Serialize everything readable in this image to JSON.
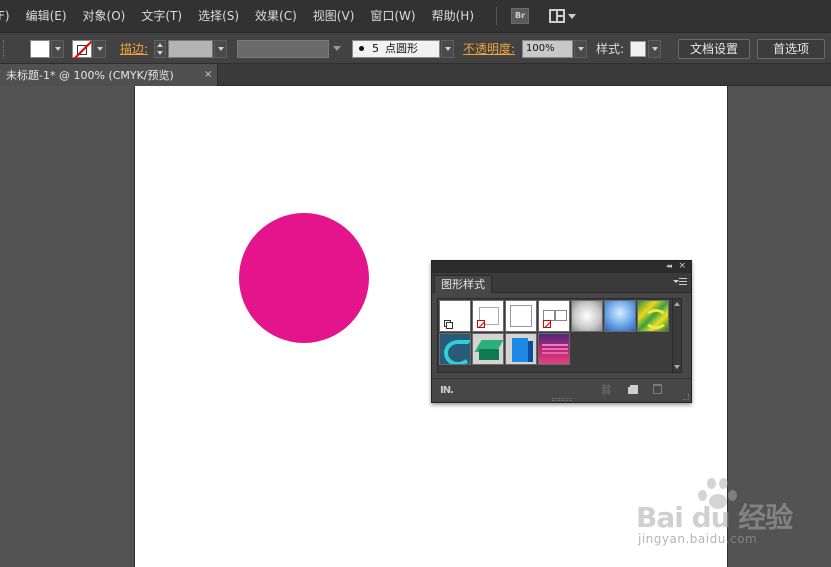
{
  "menubar": {
    "items": [
      "F)",
      "编辑(E)",
      "对象(O)",
      "文字(T)",
      "选择(S)",
      "效果(C)",
      "视图(V)",
      "窗口(W)",
      "帮助(H)"
    ],
    "bridge_label": "Br"
  },
  "controlbar": {
    "fill_color": "#e4148c",
    "stroke_label": "描边:",
    "brush_size": "5",
    "brush_shape": "点圆形",
    "opacity_label": "不透明度:",
    "opacity_value": "100%",
    "style_label": "样式:",
    "document_setup_label": "文档设置",
    "preferences_label": "首选项"
  },
  "tab": {
    "title": "未标题-1* @ 100% (CMYK/预览)",
    "close_symbol": "×"
  },
  "canvas": {
    "circle_color": "#e4148c",
    "artboard_color": "#ffffff"
  },
  "graphic_styles_panel": {
    "collapse_symbol": "◂◂",
    "close_symbol": "×",
    "tab_label": "图形样式",
    "swatches": [
      "default-style",
      "no-stroke-style",
      "white-fill-style",
      "two-boxes-style",
      "grey-radial-style",
      "blue-radial-style",
      "yellow-swirl-style",
      "teal-swirl-style",
      "green-3d-style",
      "blue-3d-style",
      "magenta-stripes-style"
    ],
    "library_label": "IN."
  },
  "watermark": {
    "logo_text": "Bai  du 经验",
    "sub_text": "jingyan.baidu.com"
  }
}
